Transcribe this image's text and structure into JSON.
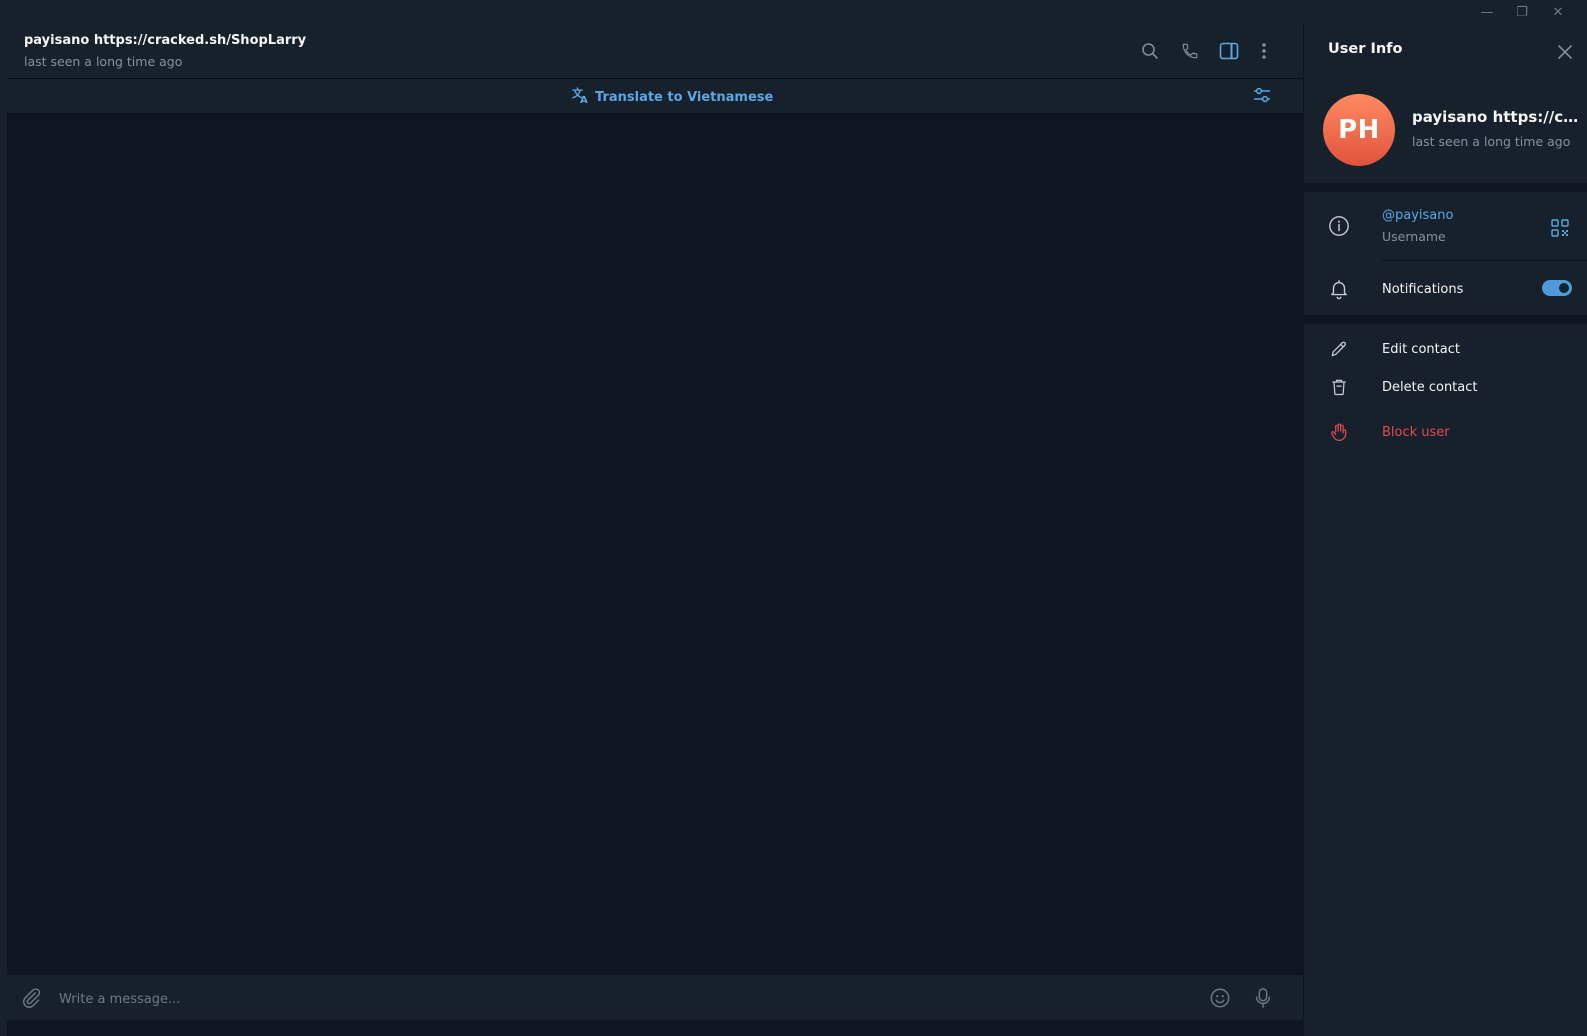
{
  "window": {
    "minimize_glyph": "—",
    "restore_glyph": "❐",
    "close_glyph": "✕"
  },
  "chat": {
    "title": "payisano https://cracked.sh/ShopLarry",
    "status": "last seen a long time ago",
    "header_icons": [
      "search-icon",
      "phone-icon",
      "sidebar-toggle-icon",
      "more-vertical-icon"
    ]
  },
  "translate": {
    "label": "Translate to Vietnamese"
  },
  "composer": {
    "placeholder": "Write a message..."
  },
  "panel": {
    "title": "User Info",
    "avatar_initials": "PH",
    "name": "payisano https://cracked.sh/ShopLarry",
    "status": "last seen a long time ago",
    "username": "@payisano",
    "username_label": "Username",
    "notifications_label": "Notifications",
    "notifications_enabled": true,
    "actions": {
      "edit_contact": "Edit contact",
      "delete_contact": "Delete contact",
      "block_user": "Block user"
    }
  },
  "colors": {
    "accent": "#5aa6e6",
    "danger": "#e5484d",
    "background": "#0e1621",
    "surface": "#17212b"
  }
}
